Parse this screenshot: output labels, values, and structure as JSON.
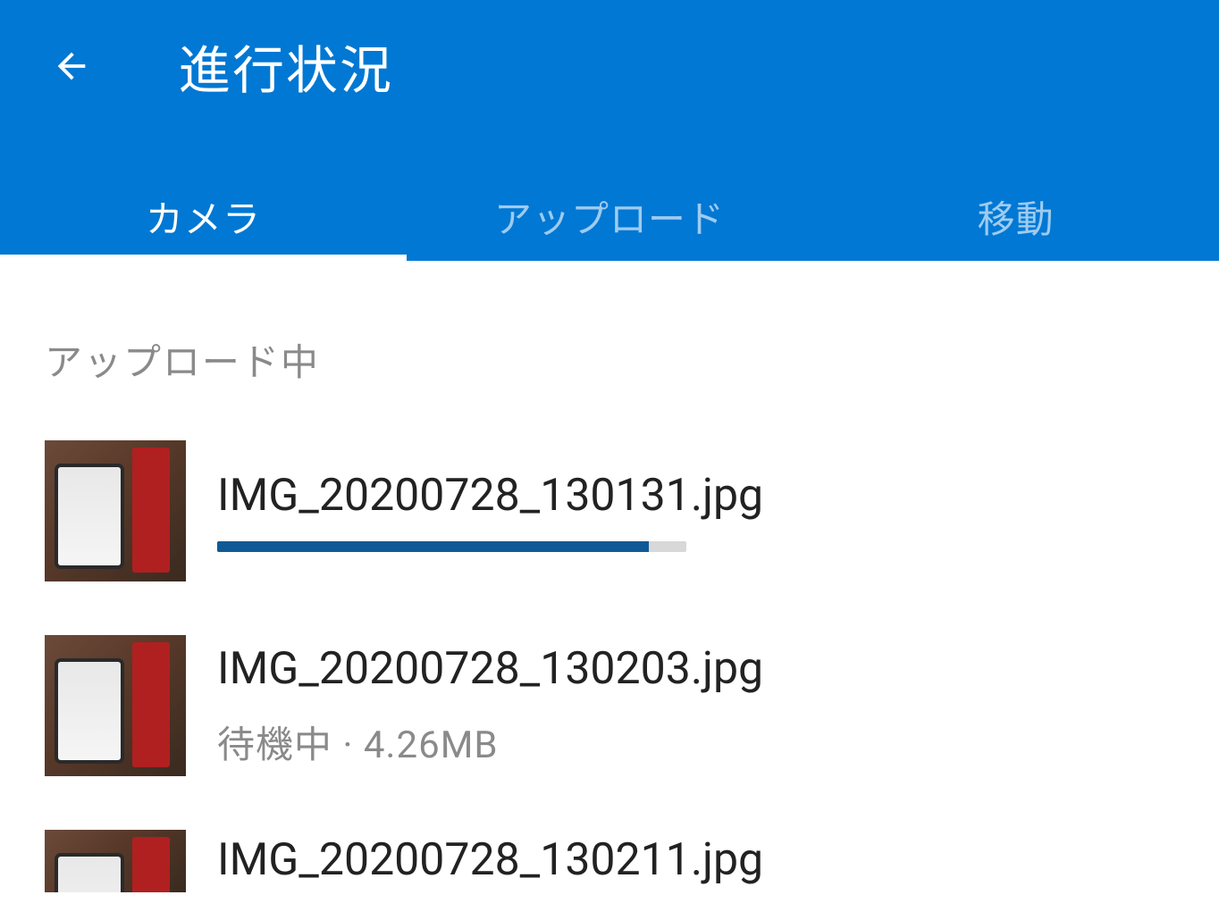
{
  "header": {
    "title": "進行状況",
    "back_icon": "back-arrow"
  },
  "tabs": [
    {
      "label": "カメラ",
      "active": true
    },
    {
      "label": "アップロード",
      "active": false
    },
    {
      "label": "移動",
      "active": false
    }
  ],
  "section_label": "アップロード中",
  "items": [
    {
      "filename": "IMG_20200728_130131.jpg",
      "mode": "progress",
      "progress_percent": 92
    },
    {
      "filename": "IMG_20200728_130203.jpg",
      "mode": "waiting",
      "status": "待機中",
      "size": "4.26MB"
    },
    {
      "filename": "IMG_20200728_130211.jpg",
      "mode": "waiting_cut",
      "status": "",
      "size": ""
    }
  ],
  "colors": {
    "brand": "#0078d4",
    "progress_fill": "#0f5a96"
  }
}
